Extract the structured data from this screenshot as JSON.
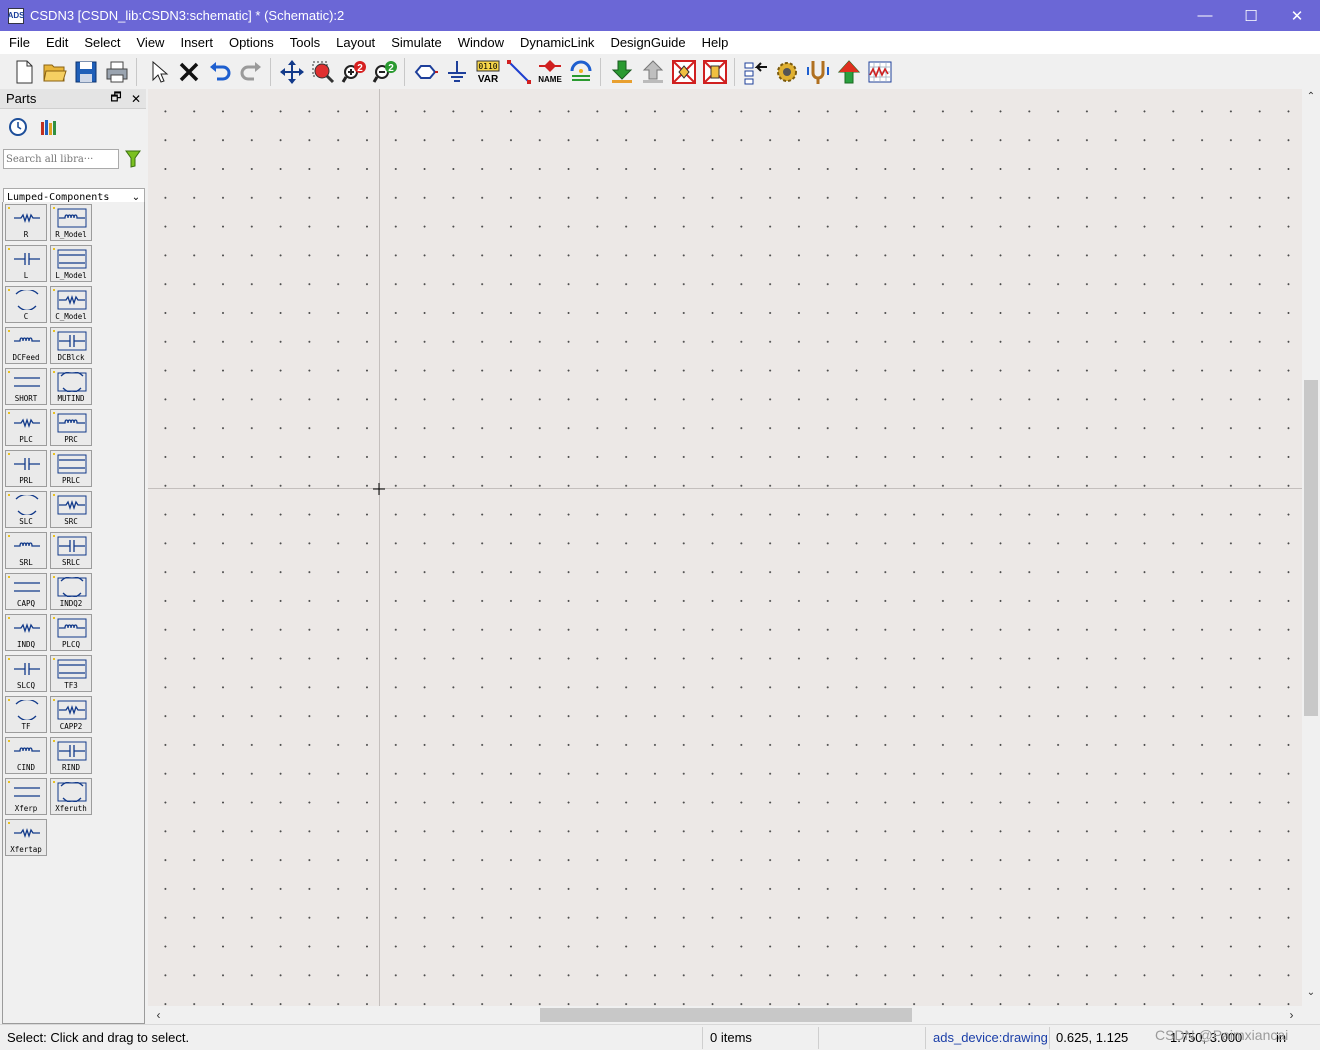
{
  "window": {
    "title": "CSDN3 [CSDN_lib:CSDN3:schematic] * (Schematic):2",
    "app_icon_text": "ADS",
    "controls": {
      "minimize": "—",
      "maximize": "☐",
      "close": "✕"
    }
  },
  "menu": [
    "File",
    "Edit",
    "Select",
    "View",
    "Insert",
    "Options",
    "Tools",
    "Layout",
    "Simulate",
    "Window",
    "DynamicLink",
    "DesignGuide",
    "Help"
  ],
  "toolbar": {
    "var_label": "VAR",
    "var_bits": "0110",
    "name_label": "NAME",
    "zoom_in_badge": "2",
    "zoom_out_badge": "2"
  },
  "parts_panel": {
    "title": "Parts",
    "float_glyph": "🗗",
    "close_glyph": "✕",
    "search_placeholder": "Search all libra···",
    "library": "Lumped-Components",
    "components": [
      "R",
      "R_Model",
      "L",
      "L_Model",
      "C",
      "C_Model",
      "DCFeed",
      "DCBlck",
      "SHORT",
      "MUTIND",
      "PLC",
      "PRC",
      "PRL",
      "PRLC",
      "SLC",
      "SRC",
      "SRL",
      "SRLC",
      "CAPQ",
      "INDQ2",
      "INDQ",
      "PLCQ",
      "SLCQ",
      "TF3",
      "TF",
      "CAPP2",
      "CIND",
      "RIND",
      "Xferp",
      "Xferuth",
      "Xfertap"
    ]
  },
  "status": {
    "hint": "Select: Click and drag to select.",
    "items": "0 items",
    "context": "ads_device:drawing",
    "coords": "0.625, 1.125",
    "coords2": "1.750, 3.000",
    "units": "in",
    "watermark": "CSDN @Paimxiancai"
  }
}
